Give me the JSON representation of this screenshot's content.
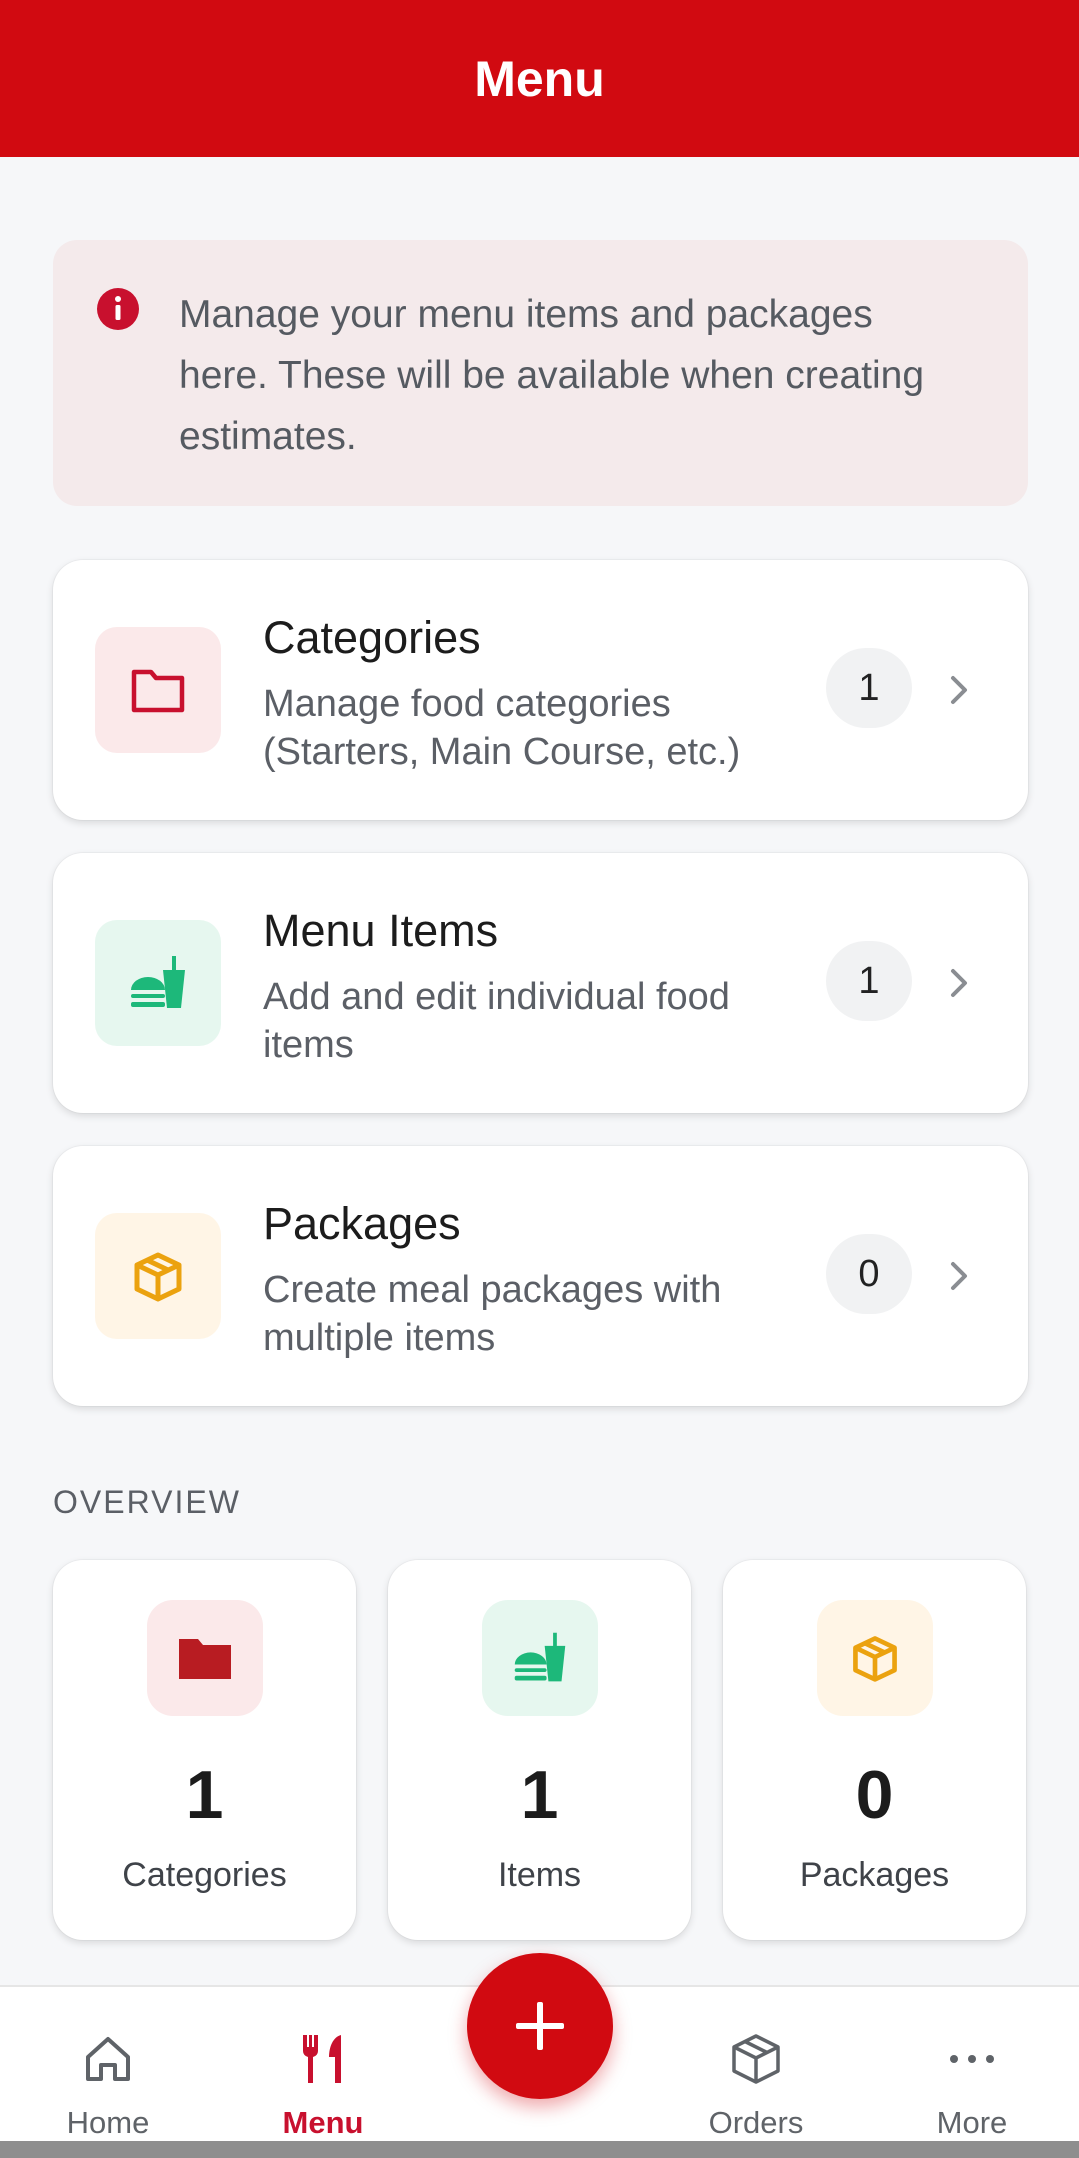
{
  "header": {
    "title": "Menu"
  },
  "info": {
    "text": "Manage your menu items and packages here. These will be available when creating estimates."
  },
  "cards": [
    {
      "title": "Categories",
      "description": "Manage food categories (Starters, Main Course, etc.)",
      "count": "1",
      "icon": "folder-icon",
      "color": "#c8102e",
      "bg": "#fbe9ea"
    },
    {
      "title": "Menu Items",
      "description": "Add and edit individual food items",
      "count": "1",
      "icon": "fastfood-icon",
      "color": "#1db87a",
      "bg": "#e6f7ef"
    },
    {
      "title": "Packages",
      "description": "Create meal packages with multiple items",
      "count": "0",
      "icon": "package-icon",
      "color": "#eba20f",
      "bg": "#fff5e6"
    }
  ],
  "overview": {
    "label": "OVERVIEW",
    "stats": [
      {
        "value": "1",
        "label": "Categories",
        "icon": "folder-icon"
      },
      {
        "value": "1",
        "label": "Items",
        "icon": "fastfood-icon"
      },
      {
        "value": "0",
        "label": "Packages",
        "icon": "package-icon"
      }
    ]
  },
  "nav": {
    "items": [
      {
        "label": "Home",
        "icon": "home-icon"
      },
      {
        "label": "Menu",
        "icon": "restaurant-icon",
        "active": true
      },
      {
        "label": "Orders",
        "icon": "box-icon"
      },
      {
        "label": "More",
        "icon": "more-icon"
      }
    ],
    "fab": "add-icon"
  },
  "colors": {
    "primary": "#d10a11",
    "green": "#1db87a",
    "amber": "#eba20f"
  }
}
